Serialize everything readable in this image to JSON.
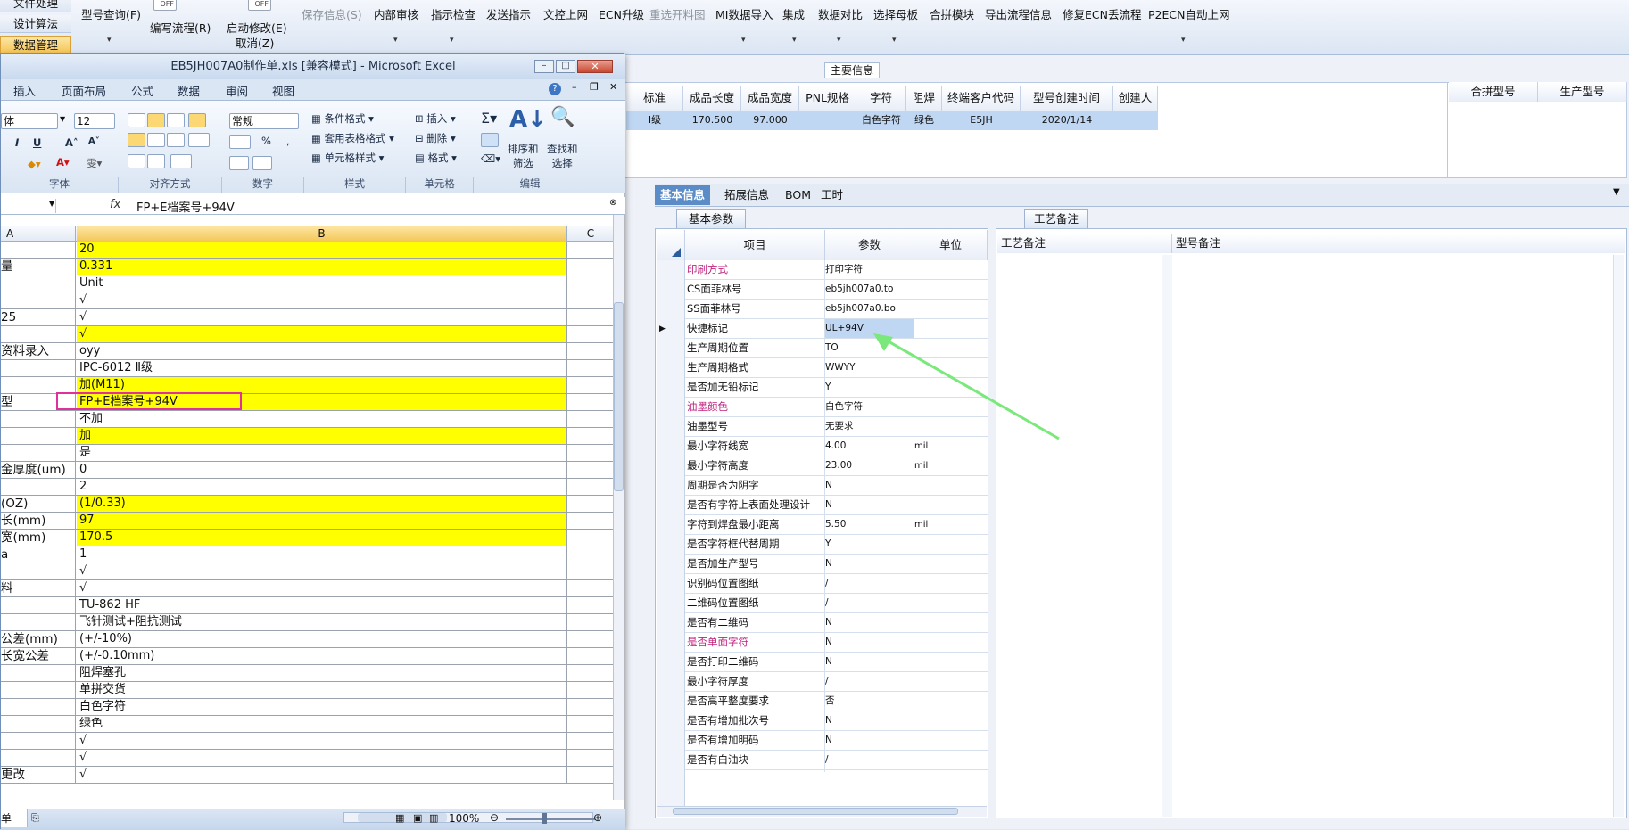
{
  "left_nav": {
    "items": [
      {
        "label": "文件处理",
        "active": false
      },
      {
        "label": "设计算法",
        "active": false
      },
      {
        "label": "数据管理",
        "active": true
      }
    ]
  },
  "toolbar": {
    "items": [
      {
        "label": "型号查询(F)",
        "disabled": false
      },
      {
        "label": "编写流程(R)",
        "disabled": false
      },
      {
        "label": "启动修改(E)",
        "disabled": false
      },
      {
        "label": "取消(Z)",
        "disabled": false
      },
      {
        "label": "保存信息(S)",
        "disabled": true
      },
      {
        "label": "内部审核",
        "disabled": false
      },
      {
        "label": "指示检查",
        "disabled": false
      },
      {
        "label": "发送指示",
        "disabled": false
      },
      {
        "label": "文控上网",
        "disabled": false
      },
      {
        "label": "ECN升级",
        "disabled": false
      },
      {
        "label": "重选开料图",
        "disabled": true
      },
      {
        "label": "MI数据导入",
        "disabled": false
      },
      {
        "label": "集成",
        "disabled": false
      },
      {
        "label": "数据对比",
        "disabled": false
      },
      {
        "label": "选择母板",
        "disabled": false
      },
      {
        "label": "合拼模块",
        "disabled": false
      },
      {
        "label": "导出流程信息",
        "disabled": false
      },
      {
        "label": "修复ECN丢流程",
        "disabled": false
      },
      {
        "label": "P2ECN自动上网",
        "disabled": false
      }
    ],
    "toggle_off": "OFF"
  },
  "main_info": {
    "label": "主要信息",
    "columns": [
      "标准",
      "成品长度",
      "成品宽度",
      "PNL规格",
      "字符",
      "阻焊",
      "终端客户代码",
      "型号创建时间",
      "创建人"
    ],
    "row": [
      "Ⅰ级",
      "170.500",
      "97.000",
      "",
      "白色字符",
      "绿色",
      "E5JH",
      "2020/1/14",
      ""
    ],
    "side_columns": [
      "合拼型号",
      "生产型号"
    ]
  },
  "tabs": {
    "main": [
      "基本信息",
      "拓展信息",
      "BOM",
      "工时"
    ],
    "basic_param": "基本参数",
    "process_note": "工艺备注"
  },
  "param_table": {
    "headers": [
      "项目",
      "参数",
      "单位"
    ],
    "rows": [
      {
        "label": "印刷方式",
        "value": "打印字符",
        "unit": "",
        "pink": true
      },
      {
        "label": "CS面菲林号",
        "value": "eb5jh007a0.to",
        "unit": "",
        "pink": false
      },
      {
        "label": "SS面菲林号",
        "value": "eb5jh007a0.bo",
        "unit": "",
        "pink": false
      },
      {
        "label": "快捷标记",
        "value": "UL+94V",
        "unit": "",
        "pink": false
      },
      {
        "label": "生产周期位置",
        "value": "TO",
        "unit": "",
        "pink": false
      },
      {
        "label": "生产周期格式",
        "value": "WWYY",
        "unit": "",
        "pink": false
      },
      {
        "label": "是否加无铅标记",
        "value": "Y",
        "unit": "",
        "pink": false
      },
      {
        "label": "油墨颜色",
        "value": "白色字符",
        "unit": "",
        "pink": true
      },
      {
        "label": "油墨型号",
        "value": "无要求",
        "unit": "",
        "pink": false
      },
      {
        "label": "最小字符线宽",
        "value": "4.00",
        "unit": "mil",
        "pink": false
      },
      {
        "label": "最小字符高度",
        "value": "23.00",
        "unit": "mil",
        "pink": false
      },
      {
        "label": "周期是否为阴字",
        "value": "N",
        "unit": "",
        "pink": false
      },
      {
        "label": "是否有字符上表面处理设计",
        "value": "N",
        "unit": "",
        "pink": false
      },
      {
        "label": "字符到焊盘最小距离",
        "value": "5.50",
        "unit": "mil",
        "pink": false
      },
      {
        "label": "是否字符框代替周期",
        "value": "Y",
        "unit": "",
        "pink": false
      },
      {
        "label": "是否加生产型号",
        "value": "N",
        "unit": "",
        "pink": false
      },
      {
        "label": "识别码位置图纸",
        "value": "/",
        "unit": "",
        "pink": false
      },
      {
        "label": "二维码位置图纸",
        "value": "/",
        "unit": "",
        "pink": false
      },
      {
        "label": "是否有二维码",
        "value": "N",
        "unit": "",
        "pink": false
      },
      {
        "label": "是否单面字符",
        "value": "N",
        "unit": "",
        "pink": true
      },
      {
        "label": "是否打印二维码",
        "value": "N",
        "unit": "",
        "pink": false
      },
      {
        "label": "最小字符厚度",
        "value": "/",
        "unit": "",
        "pink": false
      },
      {
        "label": "是否高平整度要求",
        "value": "否",
        "unit": "",
        "pink": false
      },
      {
        "label": "是否有增加批次号",
        "value": "N",
        "unit": "",
        "pink": false
      },
      {
        "label": "是否有增加明码",
        "value": "N",
        "unit": "",
        "pink": false
      },
      {
        "label": "是否有白油块",
        "value": "/",
        "unit": "",
        "pink": false
      }
    ]
  },
  "notes": {
    "headers": [
      "工艺备注",
      "型号备注"
    ]
  },
  "excel": {
    "title": "EB5JH007A0制作单.xls  [兼容模式] - Microsoft Excel",
    "tabs": [
      "插入",
      "页面布局",
      "公式",
      "数据",
      "审阅",
      "视图"
    ],
    "font_name": "体",
    "font_size": "12",
    "number_format": "常规",
    "percent": "%",
    "groups": [
      "字体",
      "对齐方式",
      "数字",
      "样式",
      "单元格",
      "编辑"
    ],
    "style_buttons": [
      "条件格式",
      "套用表格格式",
      "单元格样式"
    ],
    "cell_buttons": [
      "插入",
      "删除",
      "格式"
    ],
    "edit_buttons": [
      "排序和\n筛选",
      "查找和\n选择"
    ],
    "formula_bar": "FP+E档案号+94V",
    "columns": [
      "A",
      "B",
      "C"
    ],
    "rows": [
      {
        "a": "",
        "b": "20",
        "y": true
      },
      {
        "a": "量",
        "b": "0.331",
        "y": true
      },
      {
        "a": "",
        "b": "Unit",
        "y": false
      },
      {
        "a": "",
        "b": "√",
        "y": false
      },
      {
        "a": "25",
        "b": "√",
        "y": false
      },
      {
        "a": "",
        "b": "√",
        "y": true
      },
      {
        "a": "资料录入",
        "b": "oyy",
        "y": false
      },
      {
        "a": "",
        "b": "IPC-6012 Ⅱ级",
        "y": false
      },
      {
        "a": "",
        "b": "加(M11)",
        "y": true
      },
      {
        "a": "型",
        "b": "FP+E档案号+94V",
        "y": true
      },
      {
        "a": "",
        "b": "不加",
        "y": false
      },
      {
        "a": "",
        "b": "加",
        "y": true
      },
      {
        "a": "",
        "b": "是",
        "y": false
      },
      {
        "a": "金厚度(um)",
        "b": "0",
        "y": false
      },
      {
        "a": "",
        "b": "2",
        "y": false
      },
      {
        "a": "(OZ)",
        "b": " (1/0.33)",
        "y": true
      },
      {
        "a": "长(mm)",
        "b": "97",
        "y": true
      },
      {
        "a": "宽(mm)",
        "b": "170.5",
        "y": true
      },
      {
        "a": "a",
        "b": "1",
        "y": false
      },
      {
        "a": "",
        "b": "√",
        "y": false
      },
      {
        "a": "料",
        "b": "√",
        "y": false
      },
      {
        "a": "",
        "b": "TU-862 HF",
        "y": false
      },
      {
        "a": "",
        "b": "飞针测试+阻抗测试",
        "y": false
      },
      {
        "a": "公差(mm)",
        "b": "(+/-10%)",
        "y": false
      },
      {
        "a": "长宽公差",
        "b": "(+/-0.10mm)",
        "y": false
      },
      {
        "a": "",
        "b": "阻焊塞孔",
        "y": false
      },
      {
        "a": "",
        "b": "单拼交货",
        "y": false
      },
      {
        "a": "",
        "b": "白色字符",
        "y": false
      },
      {
        "a": "",
        "b": "绿色",
        "y": false
      },
      {
        "a": "",
        "b": "√",
        "y": false
      },
      {
        "a": "",
        "b": "√",
        "y": false
      },
      {
        "a": "更改",
        "b": "√",
        "y": false
      }
    ],
    "sheet_tab": "单",
    "zoom": "100%"
  },
  "colors": {
    "highlight_box": "#e0309a",
    "arrow": "#7be87b",
    "yellow_cell": "#ffff00",
    "active_tab": "#5b8cc8"
  }
}
